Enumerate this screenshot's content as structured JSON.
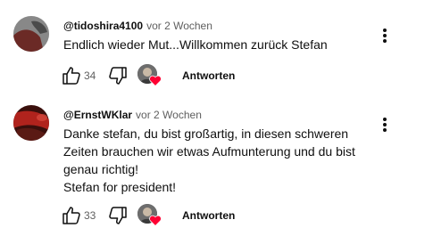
{
  "comments": [
    {
      "author": "@tidoshira4100",
      "time": "vor 2 Wochen",
      "text": "Endlich wieder Mut...Willkommen zurück Stefan",
      "likes": "34",
      "reply_label": "Antworten",
      "avatar_colors": [
        "#6b2a26",
        "#8a8a8a"
      ]
    },
    {
      "author": "@ErnstWKlar",
      "time": "vor 2 Wochen",
      "text": "Danke stefan, du bist großartig, in diesen schweren\nZeiten brauchen wir etwas Aufmunterung und du bist\ngenau richtig!\nStefan for president!",
      "likes": "33",
      "reply_label": "Antworten",
      "avatar_colors": [
        "#b0231d",
        "#4a1410"
      ]
    }
  ],
  "icons": {
    "like": "thumbs-up-icon",
    "dislike": "thumbs-down-icon",
    "more": "more-vertical-icon",
    "heart": "heart-icon"
  },
  "colors": {
    "heart": "#ff0033",
    "secondary_text": "#606060"
  }
}
